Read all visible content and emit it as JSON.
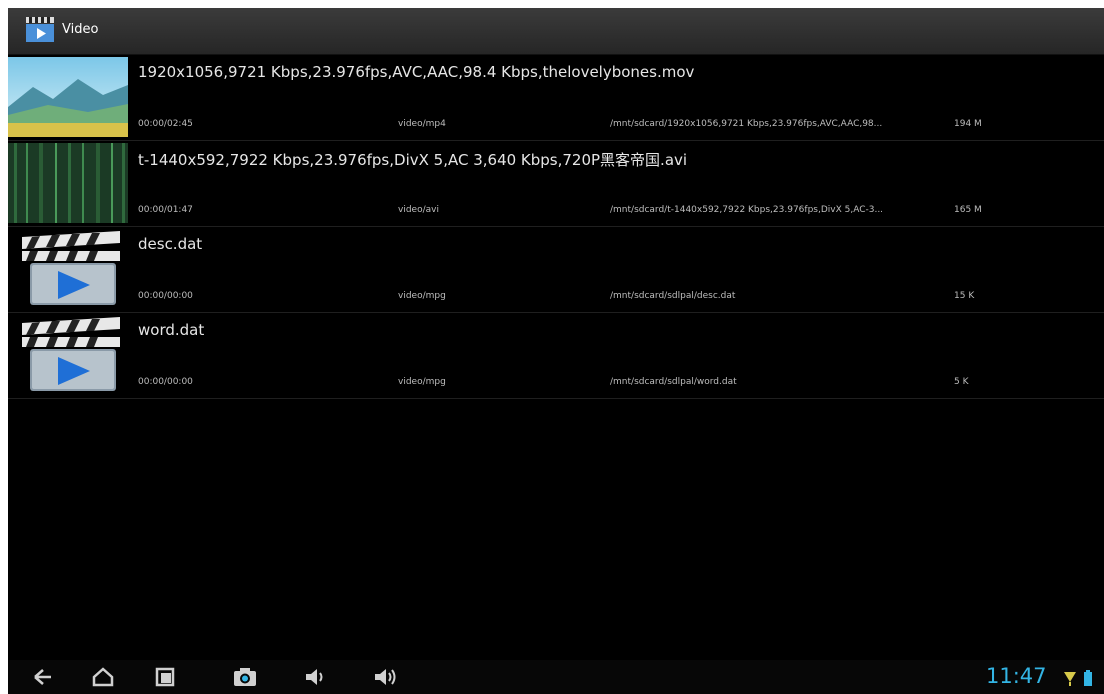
{
  "app": {
    "title": "Video",
    "icon": "video-clapper-icon"
  },
  "videos": [
    {
      "title": "1920x1056,9721 Kbps,23.976fps,AVC,AAC,98.4 Kbps,thelovelybones.mov",
      "duration": "00:00/02:45",
      "mime": "video/mp4",
      "path": "/mnt/sdcard/1920x1056,9721 Kbps,23.976fps,AVC,AAC,98...",
      "size": "194 M",
      "thumbnail": "landscape-thumbnail"
    },
    {
      "title": "t-1440x592,7922 Kbps,23.976fps,DivX 5,AC 3,640 Kbps,720P黑客帝国.avi",
      "duration": "00:00/01:47",
      "mime": "video/avi",
      "path": "/mnt/sdcard/t-1440x592,7922 Kbps,23.976fps,DivX 5,AC-3...",
      "size": "165 M",
      "thumbnail": "green-code-thumbnail"
    },
    {
      "title": "desc.dat",
      "duration": "00:00/00:00",
      "mime": "video/mpg",
      "path": "/mnt/sdcard/sdlpal/desc.dat",
      "size": "15 K",
      "thumbnail": "default-video-icon"
    },
    {
      "title": "word.dat",
      "duration": "00:00/00:00",
      "mime": "video/mpg",
      "path": "/mnt/sdcard/sdlpal/word.dat",
      "size": "5 K",
      "thumbnail": "default-video-icon"
    }
  ],
  "navbar": {
    "buttons": [
      "back-icon",
      "home-icon",
      "recent-apps-icon",
      "camera-icon",
      "volume-down-icon",
      "volume-up-icon"
    ],
    "clock": "11:47",
    "accent_color": "#33b5e5"
  }
}
